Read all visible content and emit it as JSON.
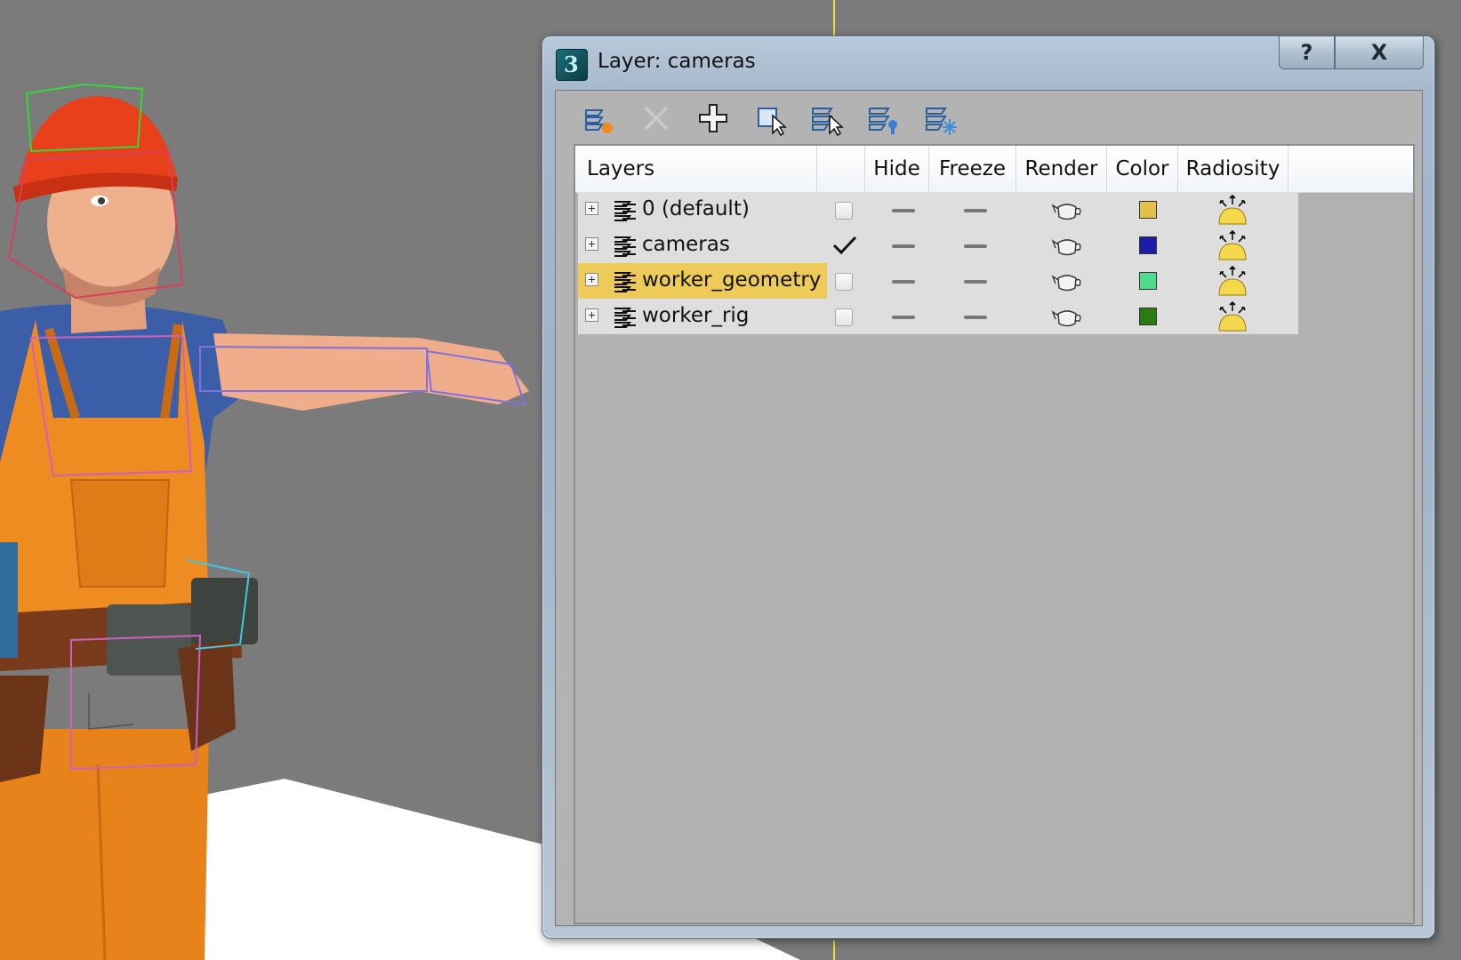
{
  "dialog": {
    "title": "Layer: cameras",
    "help_label": "?",
    "close_label": "X"
  },
  "toolbar": {
    "tools": [
      {
        "icon": "create-layer-icon",
        "enabled": true
      },
      {
        "icon": "delete-layer-icon",
        "enabled": false
      },
      {
        "icon": "add-to-layer-icon",
        "enabled": true
      },
      {
        "icon": "select-objects-icon",
        "enabled": true
      },
      {
        "icon": "highlight-selected-icon",
        "enabled": true
      },
      {
        "icon": "hide-unhide-all-icon",
        "enabled": true
      },
      {
        "icon": "freeze-unfreeze-all-icon",
        "enabled": true
      }
    ]
  },
  "columns": {
    "layers": "Layers",
    "current": "",
    "hide": "Hide",
    "freeze": "Freeze",
    "render": "Render",
    "color": "Color",
    "radiosity": "Radiosity"
  },
  "layers": [
    {
      "name": "0 (default)",
      "current": false,
      "selected": false,
      "color": "#e2c04a"
    },
    {
      "name": "cameras",
      "current": true,
      "selected": false,
      "color": "#1c1ca8"
    },
    {
      "name": "worker_geometry",
      "current": false,
      "selected": true,
      "color": "#4fdc8c"
    },
    {
      "name": "worker_rig",
      "current": false,
      "selected": false,
      "color": "#2b7a12"
    }
  ],
  "icons": {
    "expander": "expand-plus-icon",
    "layer": "layer-stack-icon",
    "render": "teapot-icon",
    "radiosity": "radiosity-sun-icon"
  }
}
